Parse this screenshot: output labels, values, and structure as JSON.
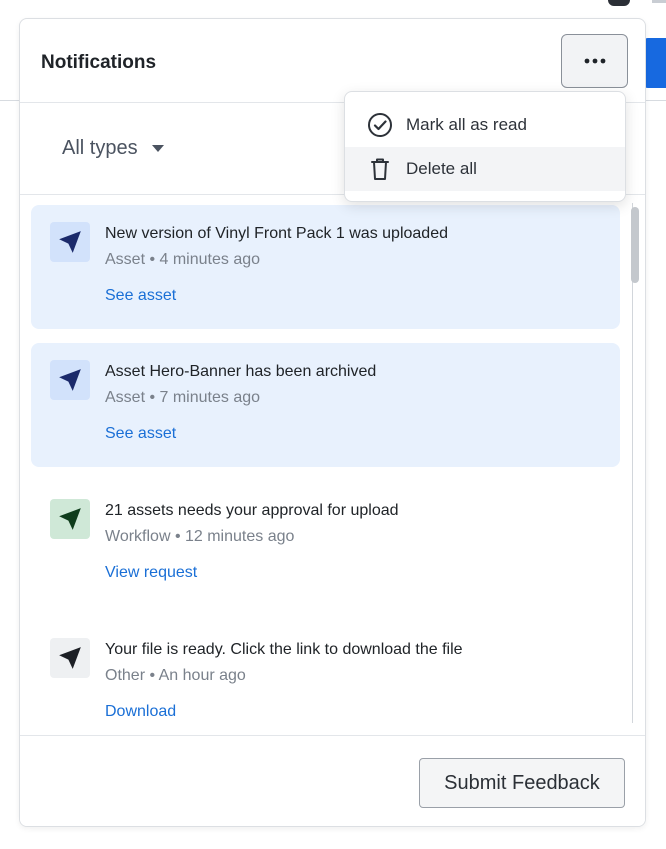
{
  "panel": {
    "title": "Notifications",
    "more_icon": "ellipsis-icon"
  },
  "menu": {
    "items": [
      {
        "label": "Mark all as read",
        "icon": "check-circle-icon"
      },
      {
        "label": "Delete all",
        "icon": "trash-icon"
      }
    ]
  },
  "filter": {
    "label": "All types",
    "icon": "caret-down-icon"
  },
  "notifications": [
    {
      "message": "New version of Vinyl Front Pack 1 was uploaded",
      "meta": "Asset • 4 minutes ago",
      "link": "See asset",
      "unread": true,
      "icon_color": "#1b2a6b"
    },
    {
      "message": "Asset Hero-Banner has been archived",
      "meta": "Asset • 7 minutes ago",
      "link": "See asset",
      "unread": true,
      "icon_color": "#1b2a6b"
    },
    {
      "message": "21 assets needs your approval for upload",
      "meta": "Workflow • 12 minutes ago",
      "link": "View request",
      "unread": false,
      "icon_color": "#0f3d1c"
    },
    {
      "message": "Your file is ready. Click the link to download the file",
      "meta": "Other • An hour ago",
      "link": "Download",
      "unread": false,
      "icon_color": "#1c1f25"
    }
  ],
  "footer": {
    "feedback_label": "Submit Feedback"
  },
  "colors": {
    "accent": "#1a6fd6",
    "unread_bg": "#e8f1fd"
  }
}
